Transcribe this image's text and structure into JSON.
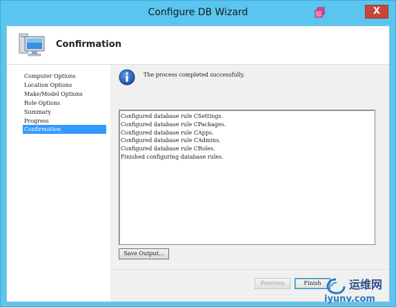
{
  "window": {
    "title": "Configure DB Wizard",
    "close_label": "X",
    "accent_color": "#5ac6ef"
  },
  "header": {
    "title": "Confirmation",
    "icon": "computer-icon"
  },
  "nav": {
    "items": [
      {
        "label": "Computer Options",
        "active": false
      },
      {
        "label": "Location Options",
        "active": false
      },
      {
        "label": "Make/Model Options",
        "active": false
      },
      {
        "label": "Role Options",
        "active": false
      },
      {
        "label": "Summary",
        "active": false
      },
      {
        "label": "Progress",
        "active": false
      },
      {
        "label": "Confirmation",
        "active": true
      }
    ],
    "active_color": "#3399ff"
  },
  "status": {
    "icon": "info-icon",
    "text": "The process completed successfully."
  },
  "log": {
    "lines": [
      "Configured database rule CSettings.",
      "Configured database rule CPackages.",
      "Configured database rule CApps.",
      "Configured database rule CAdmins.",
      "Configured database rule CRoles.",
      "Finished configuring database rules."
    ]
  },
  "buttons": {
    "save_output": "Save Output...",
    "previous": "Previous",
    "finish": "Finish"
  },
  "watermark": {
    "name": "运维网",
    "url": "iyunv.com"
  }
}
